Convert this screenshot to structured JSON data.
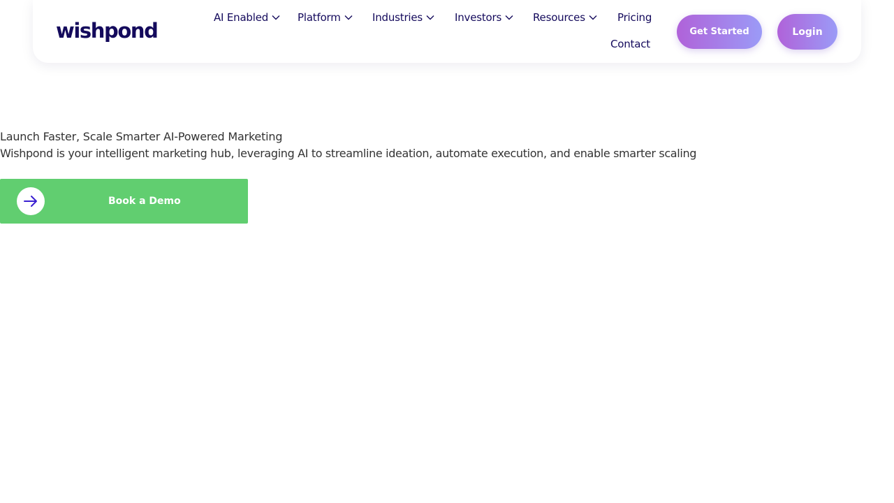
{
  "brand": {
    "logo_text": "wishpond",
    "color": "#140a5c"
  },
  "nav": {
    "items": [
      {
        "label": "AI Enabled",
        "has_dropdown": true
      },
      {
        "label": "Platform",
        "has_dropdown": true
      },
      {
        "label": "Industries",
        "has_dropdown": true
      },
      {
        "label": "Investors",
        "has_dropdown": true
      },
      {
        "label": "Resources",
        "has_dropdown": true
      },
      {
        "label": "Pricing",
        "has_dropdown": false
      },
      {
        "label": "Contact",
        "has_dropdown": false
      }
    ],
    "get_started_label": "Get Started",
    "login_label": "Login",
    "button_gradient": [
      "#b062d9",
      "#9b9bf7"
    ]
  },
  "hero": {
    "title": "Launch Faster, Scale Smarter AI-Powered Marketing",
    "subtitle": "Wishpond is your intelligent marketing hub, leveraging AI to streamline ideation, automate execution, and enable smarter scaling",
    "cta_label": "Book a Demo",
    "cta_icon": "arrow-right-icon",
    "cta_color": "#61ce70",
    "cta_icon_color": "#3a1fd1"
  }
}
